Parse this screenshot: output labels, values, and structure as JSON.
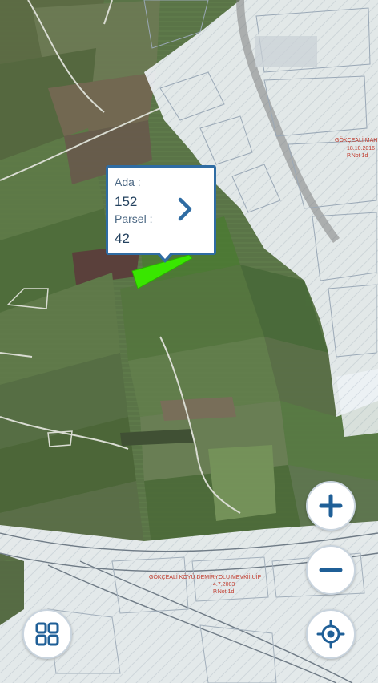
{
  "popup": {
    "ada_label": "Ada :",
    "ada_value": "152",
    "parsel_label": "Parsel :",
    "parsel_value": "42",
    "accent_color": "#2f6ca3"
  },
  "map_labels": {
    "village_top": "GÖKÇEALİ MAH",
    "date_top": "18.10.2016",
    "plan_top": "P.Not 1d",
    "rail_title": "GÖKÇEALİ KÖYÜ DEMİRYOLU MEVKİİ UİP",
    "rail_date": "4.7.2003",
    "rail_plan": "P.Not 1d"
  },
  "controls": {
    "zoom_in_icon": "plus-icon",
    "zoom_out_icon": "minus-icon",
    "locate_icon": "crosshair-target-icon",
    "menu_icon": "grid-four-squares-icon",
    "button_color": "#1f5f97"
  },
  "colors": {
    "selected_parcel": "#39e600",
    "plan_overlay": "#e9eef3",
    "plan_lines": "#9aa8b6"
  }
}
